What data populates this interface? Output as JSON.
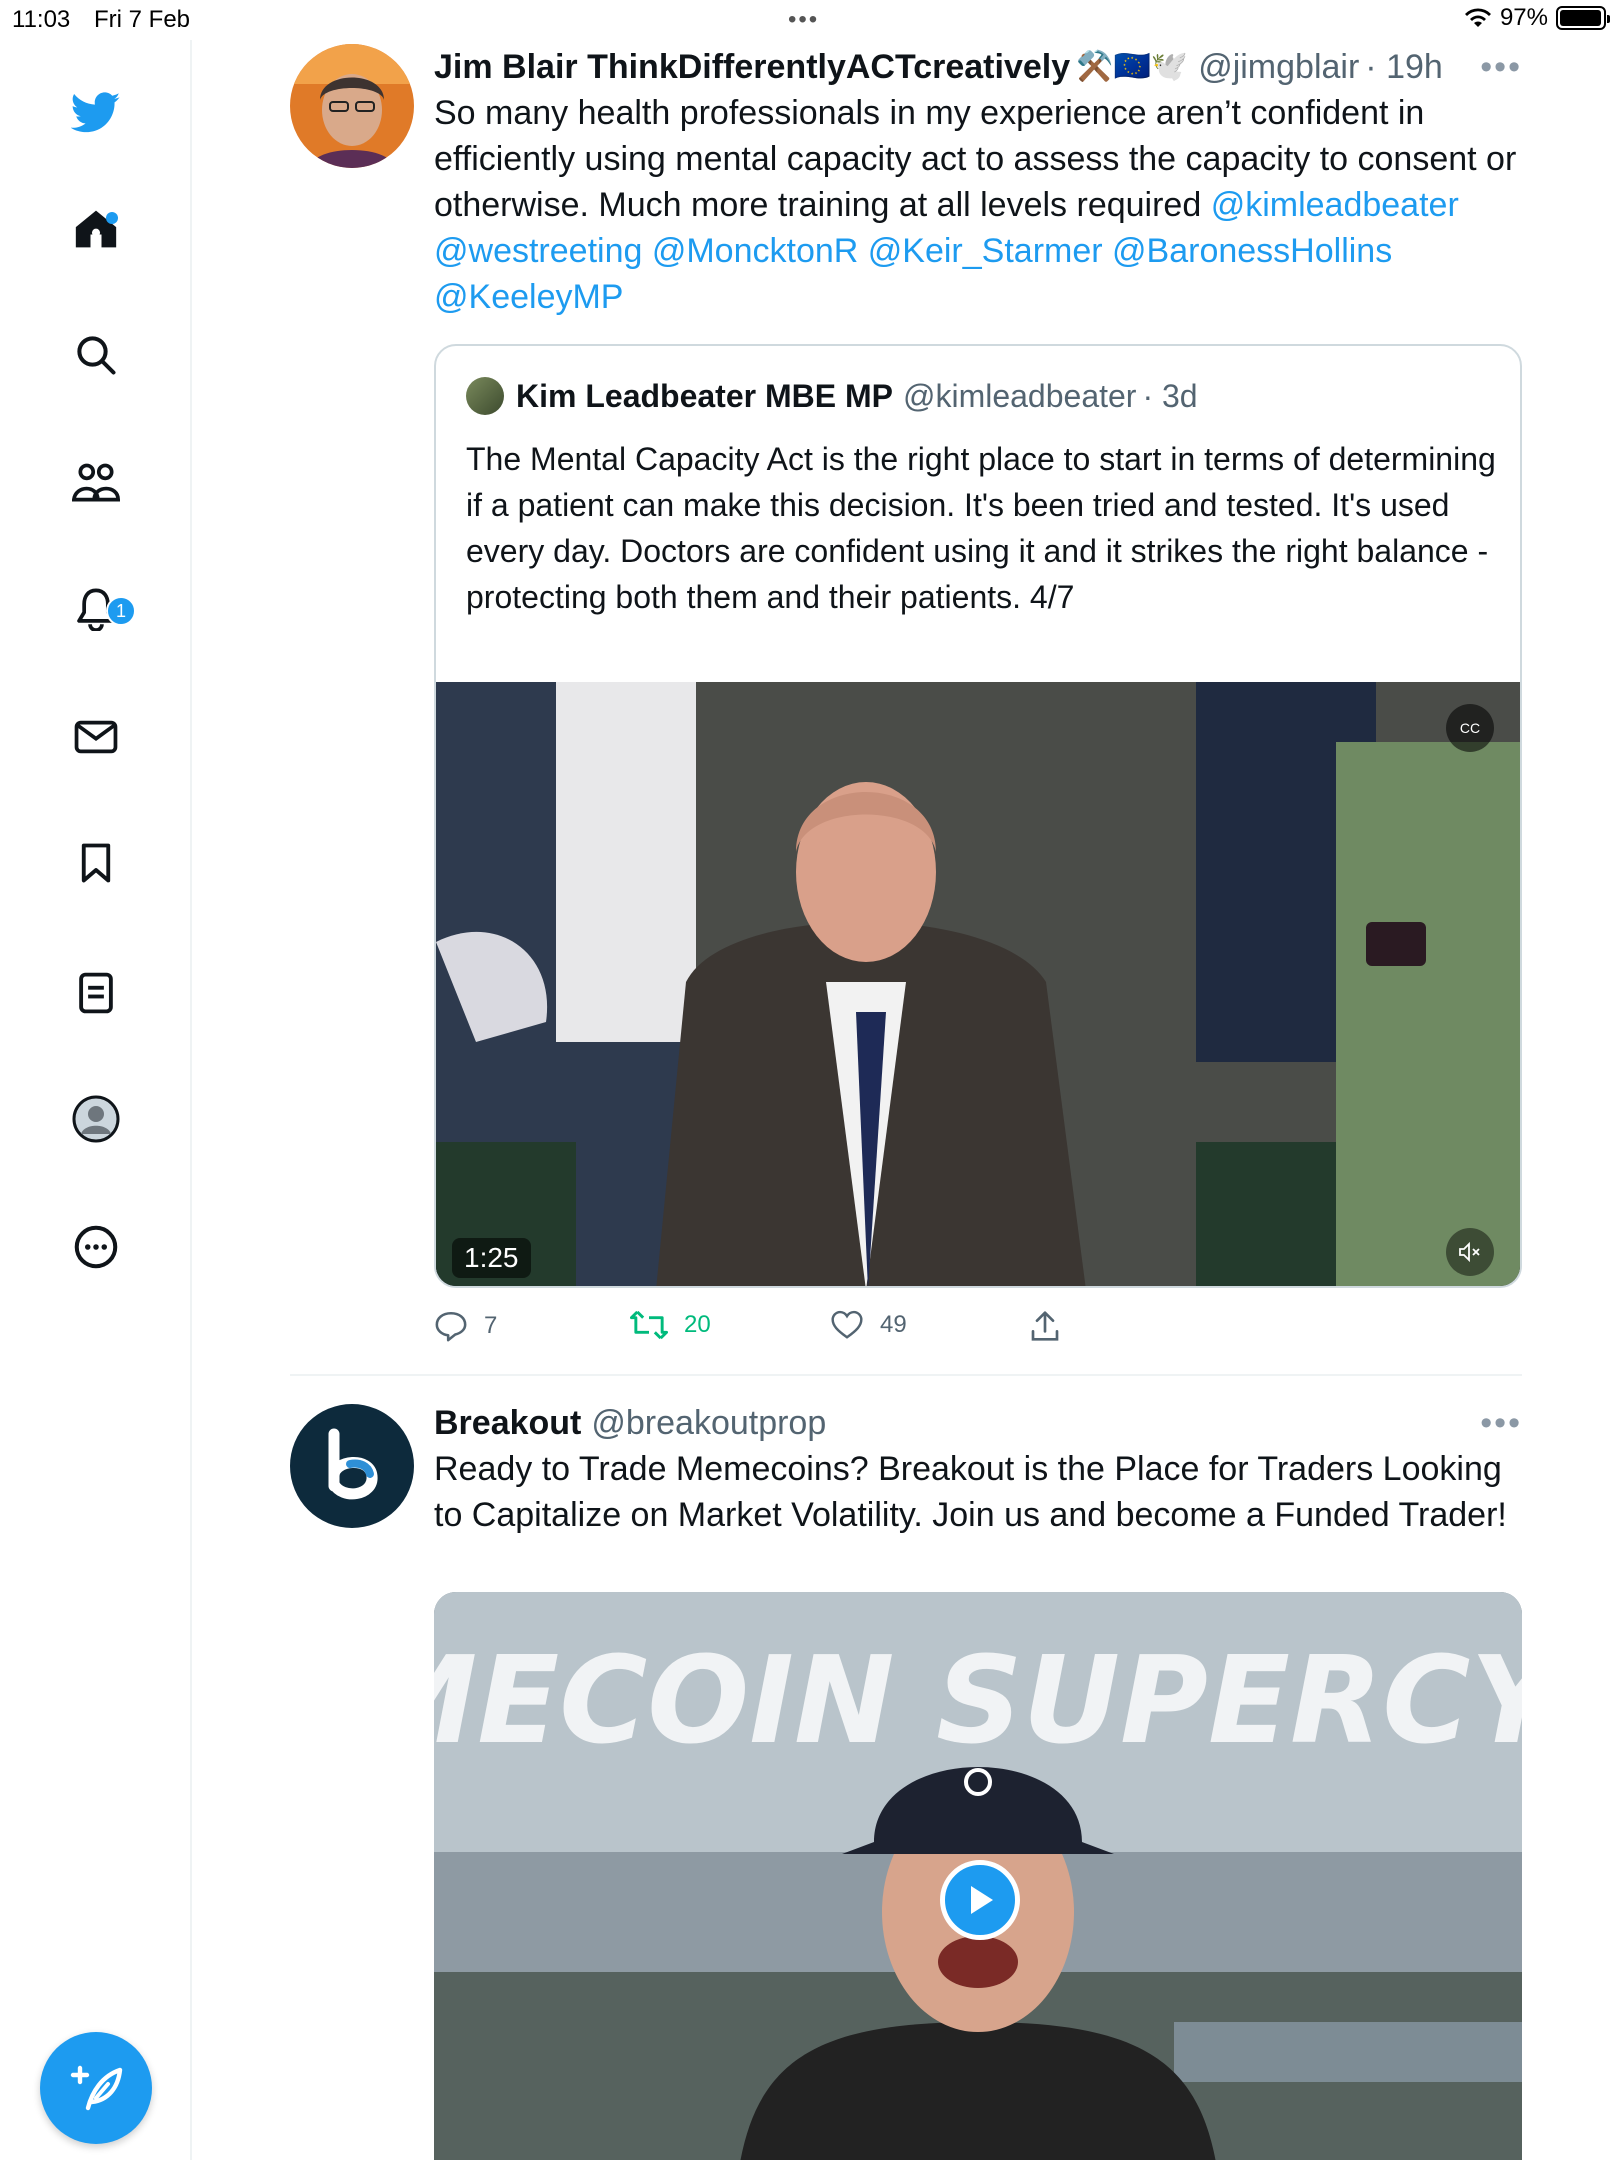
{
  "status_bar": {
    "time": "11:03",
    "date": "Fri 7 Feb",
    "battery": "97%",
    "battery_level": 0.97
  },
  "sidebar": {
    "notifications_badge": "1",
    "items": [
      "twitter-logo",
      "home",
      "explore",
      "communities",
      "notifications",
      "messages",
      "bookmarks",
      "lists",
      "profile",
      "more"
    ]
  },
  "tweet1": {
    "name": "Jim Blair ThinkDifferentlyACTcreatively",
    "emojis": "⚒️🇪🇺🕊️",
    "handle": "@jimgblair",
    "time": "· 19h",
    "more": "•••",
    "text": "So many health professionals in my experience  aren’t confident  in efficiently using mental capacity act to assess the capacity to consent or otherwise. Much more training at all levels required ",
    "mentions_line1": "@kimleadbeater",
    "mentions": [
      "@westreeting",
      "@MoncktonR",
      "@Keir_Starmer",
      "@BaronessHollins",
      "@KeeleyMP"
    ],
    "quote": {
      "name": "Kim Leadbeater MBE MP",
      "handle": "@kimleadbeater",
      "time": "· 3d",
      "text": "The Mental Capacity Act is the right place to start in terms of determining if a patient can make this decision. It's been tried and tested. It's used every day. Doctors are confident using it and it strikes the right balance - protecting both them and their patients. 4/7",
      "video_time": "1:25",
      "cc_label": "CC"
    },
    "replies": "7",
    "retweets": "20",
    "likes": "49"
  },
  "tweet2": {
    "name": "Breakout",
    "handle": "@breakoutprop",
    "more": "•••",
    "text": "Ready to Trade Memecoins? Breakout is the Place for Traders Looking to Capitalize on Market Volatility. Join us and become a Funded Trader!",
    "media_headline": "MEMECOIN SUPERCYCLE"
  },
  "colors": {
    "accent": "#1d9bf0",
    "retweet_green": "#00ba7c",
    "text": "#0f1419",
    "secondary": "#536471"
  }
}
